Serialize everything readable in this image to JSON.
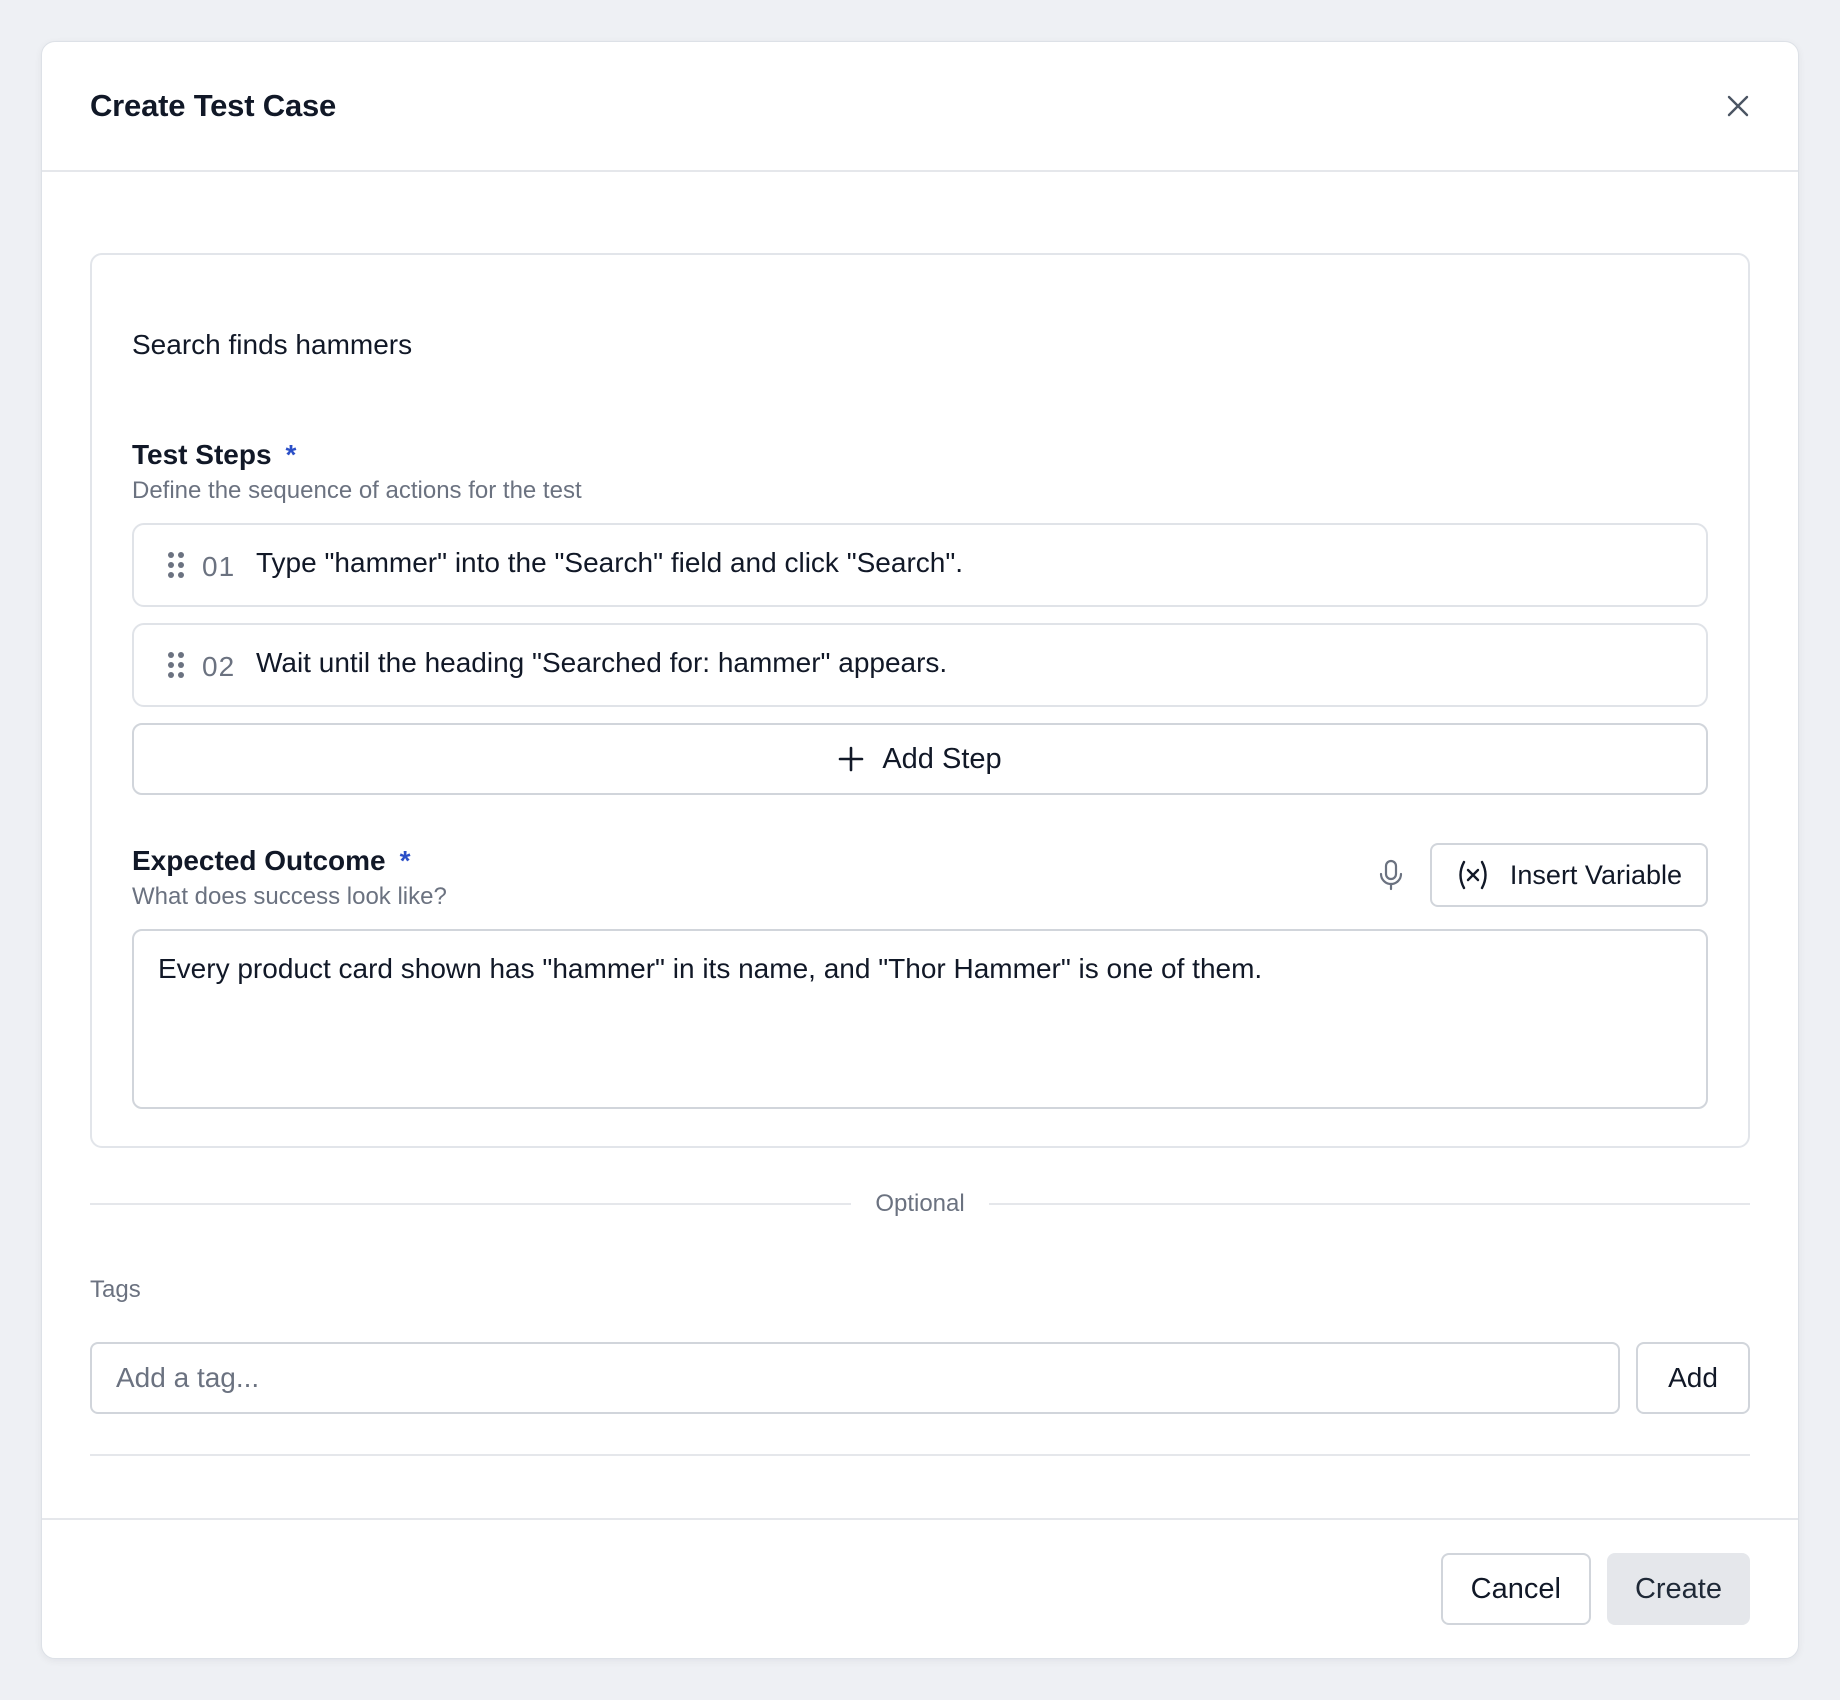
{
  "modal": {
    "title": "Create Test Case",
    "close_icon": "close-icon"
  },
  "test_case": {
    "name": "Search finds hammers"
  },
  "test_steps": {
    "label": "Test Steps",
    "required_marker": "*",
    "description": "Define the sequence of actions for the test",
    "steps": [
      {
        "number": "01",
        "text": "Type \"hammer\" into the \"Search\" field and click \"Search\"."
      },
      {
        "number": "02",
        "text": "Wait until the heading \"Searched for: hammer\" appears."
      }
    ],
    "add_step_label": "Add Step"
  },
  "expected_outcome": {
    "label": "Expected Outcome",
    "required_marker": "*",
    "description": "What does success look like?",
    "insert_variable_label": "Insert Variable",
    "value": "Every product card shown has \"hammer\" in its name, and \"Thor Hammer\" is one of them."
  },
  "optional_divider_label": "Optional",
  "tags": {
    "label": "Tags",
    "placeholder": "Add a tag...",
    "add_label": "Add"
  },
  "footer": {
    "cancel_label": "Cancel",
    "create_label": "Create"
  },
  "colors": {
    "accent_required": "#2b4fc7",
    "muted_text": "#6b7280",
    "border": "#d1d5db",
    "create_button_bg": "#e5e7eb"
  }
}
